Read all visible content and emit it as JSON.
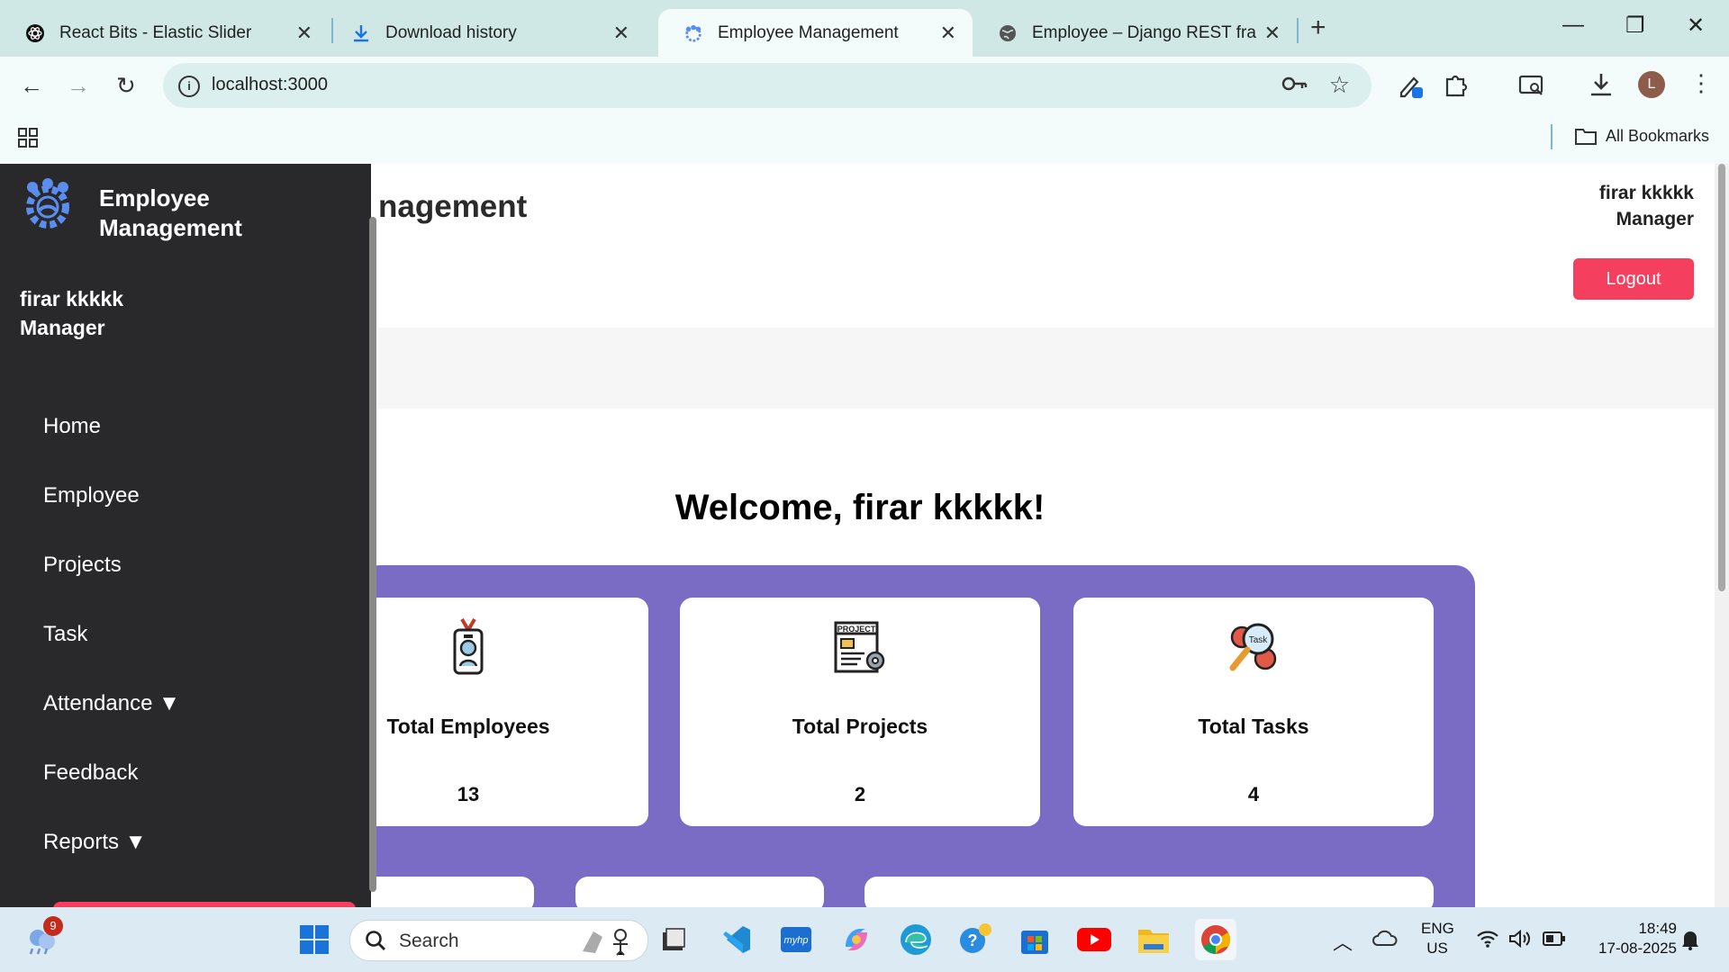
{
  "browser": {
    "tabs": [
      {
        "title": "React Bits - Elastic Slider",
        "icon": "react-bits-icon"
      },
      {
        "title": "Download history",
        "icon": "download-icon"
      },
      {
        "title": "Employee Management",
        "icon": "team-gear-icon",
        "active": true
      },
      {
        "title": "Employee – Django REST frame",
        "icon": "globe-icon"
      }
    ],
    "address": "localhost:3000",
    "bookmarks_label": "All Bookmarks",
    "profile_initial": "L"
  },
  "header": {
    "page_title": "nagement",
    "user_name": "firar kkkkk",
    "user_role": "Manager",
    "logout_label": "Logout"
  },
  "sidebar": {
    "brand_line1": "Employee",
    "brand_line2": "Management",
    "user_name": "firar kkkkk",
    "user_role": "Manager",
    "items": [
      {
        "label": "Home"
      },
      {
        "label": "Employee"
      },
      {
        "label": "Projects"
      },
      {
        "label": "Task"
      },
      {
        "label": "Attendance ▼"
      },
      {
        "label": "Feedback"
      },
      {
        "label": "Reports ▼"
      }
    ]
  },
  "main": {
    "welcome": "Welcome, firar kkkkk!",
    "accent_color": "#7a6cc5",
    "stats": [
      {
        "label": "Total Employees",
        "value": "13",
        "icon": "id-badge-icon"
      },
      {
        "label": "Total Projects",
        "value": "2",
        "icon": "project-document-icon"
      },
      {
        "label": "Total Tasks",
        "value": "4",
        "icon": "task-magnifier-gear-icon"
      }
    ]
  },
  "taskbar": {
    "search_placeholder": "Search",
    "notification_count": "9",
    "language_line1": "ENG",
    "language_line2": "US",
    "time": "18:49",
    "date": "17-08-2025"
  }
}
